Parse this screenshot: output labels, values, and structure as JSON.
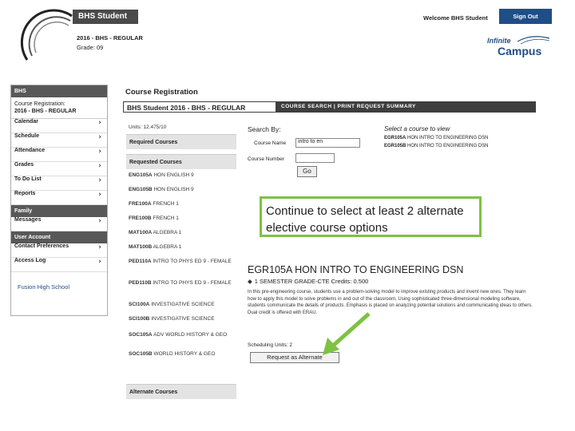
{
  "header": {
    "app_name": "BHS Student",
    "year_line": "2016 - BHS - REGULAR",
    "grade_line": "Grade: 09",
    "welcome": "Welcome BHS Student",
    "signout_label": "Sign Out",
    "logo_top": "Infinite",
    "logo_bottom": "Campus"
  },
  "sidebar": {
    "header": "BHS",
    "course_reg_line1": "Course Registration:",
    "course_reg_line2": "2016 - BHS - REGULAR",
    "items_a": [
      "Calendar",
      "Schedule",
      "Attendance",
      "Grades",
      "To Do List",
      "Reports"
    ],
    "family_header": "Family",
    "items_b": [
      "Messages"
    ],
    "account_header": "User Account",
    "items_c": [
      "Contact Preferences",
      "Access Log"
    ],
    "school": "Fusion High School"
  },
  "main": {
    "title": "Course Registration",
    "bar_student": "BHS Student    2016 - BHS - REGULAR",
    "bar_tabs": "COURSE SEARCH  |  PRINT REQUEST SUMMARY",
    "info_text": "Units: 12.475/10",
    "required_header": "Required Courses",
    "requested_header": "Requested Courses",
    "requested": [
      {
        "code": "ENG105A",
        "name": "HON ENGLISH 9"
      },
      {
        "code": "ENG105B",
        "name": "HON ENGLISH 9"
      },
      {
        "code": "FRE100A",
        "name": "FRENCH 1"
      },
      {
        "code": "FRE100B",
        "name": "FRENCH 1"
      },
      {
        "code": "MAT100A",
        "name": "ALGEBRA 1"
      },
      {
        "code": "MAT100B",
        "name": "ALGEBRA 1"
      },
      {
        "code": "PED110A",
        "name": "INTRO TO PHYS ED 9 - FEMALE"
      },
      {
        "code": "PED110B",
        "name": "INTRO TO PHYS ED 9 - FEMALE"
      },
      {
        "code": "SCI100A",
        "name": "INVESTIGATIVE SCIENCE"
      },
      {
        "code": "SCI100B",
        "name": "INVESTIGATIVE SCIENCE"
      },
      {
        "code": "SOC105A",
        "name": "ADV WORLD HISTORY & GEO"
      },
      {
        "code": "SOC105B",
        "name": "WORLD HISTORY & GEO"
      }
    ],
    "alternate_header": "Alternate Courses"
  },
  "search": {
    "title": "Search By:",
    "course_name_label": "Course Name",
    "course_name_value": "intro to en",
    "course_number_label": "Course Number",
    "course_number_value": "",
    "go_label": "Go",
    "select_title": "Select a course to view",
    "results": [
      {
        "code": "EGR105A",
        "name": "HON INTRO TO ENGINEERING DSN"
      },
      {
        "code": "EGR105B",
        "name": "HON INTRO TO ENGINEERING DSN"
      }
    ]
  },
  "callout": {
    "text": "Continue to select at least 2 alternate elective course options",
    "border_color": "#7dc242"
  },
  "detail": {
    "title": "EGR105A HON INTRO TO ENGINEERING DSN",
    "subtitle": "1 SEMESTER GRADE-CTE Credits: 0.500",
    "description": "In this pre-engineering course, students use a problem-solving model to improve existing products and invent new ones. They learn how to apply this model to solve problems in and out of the classroom. Using sophisticated three-dimensional modeling software, students communicate the details of products. Emphasis is placed on analyzing potential solutions and communicating ideas to others. Dual credit is offered with ERAU.",
    "sched_units": "Scheduling Units: 2",
    "request_button": "Request as Alternate"
  },
  "colors": {
    "accent": "#1f4e87",
    "arrow": "#7dc242"
  }
}
